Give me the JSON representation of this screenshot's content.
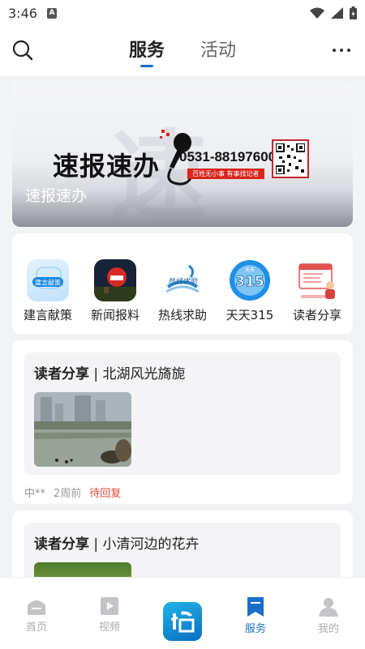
{
  "status_bar": {
    "time": "3:46",
    "sim_label": "A"
  },
  "header": {
    "tabs": [
      {
        "label": "服务",
        "active": true
      },
      {
        "label": "活动",
        "active": false
      }
    ]
  },
  "banner": {
    "big_title": "速报速办",
    "phone": "0531-88197600",
    "slogan": "百姓无小事  有事找记者",
    "caption": "速报速办",
    "bg_char": "速"
  },
  "services": [
    {
      "label": "建言献策",
      "icon": "suggestion-icon"
    },
    {
      "label": "新闻报料",
      "icon": "news-tip-icon"
    },
    {
      "label": "热线求助",
      "icon": "hotline-icon"
    },
    {
      "label": "天天315",
      "icon": "consumer-315-icon"
    },
    {
      "label": "读者分享",
      "icon": "reader-share-icon"
    }
  ],
  "posts": [
    {
      "tag": "读者分享",
      "title": "北湖风光旖旎",
      "author": "中**",
      "time": "2周前",
      "status": "待回复"
    },
    {
      "tag": "读者分享",
      "title": "小清河边的花卉"
    }
  ],
  "tabbar": [
    {
      "label": "首页",
      "icon": "home-icon",
      "active": false
    },
    {
      "label": "视频",
      "icon": "video-icon",
      "active": false
    },
    {
      "label": "",
      "icon": "app-logo",
      "active": false
    },
    {
      "label": "服务",
      "icon": "service-bookmark-icon",
      "active": true
    },
    {
      "label": "我的",
      "icon": "profile-icon",
      "active": false
    }
  ],
  "colors": {
    "accent": "#1a6fc9",
    "status_red": "#e04a3a"
  }
}
